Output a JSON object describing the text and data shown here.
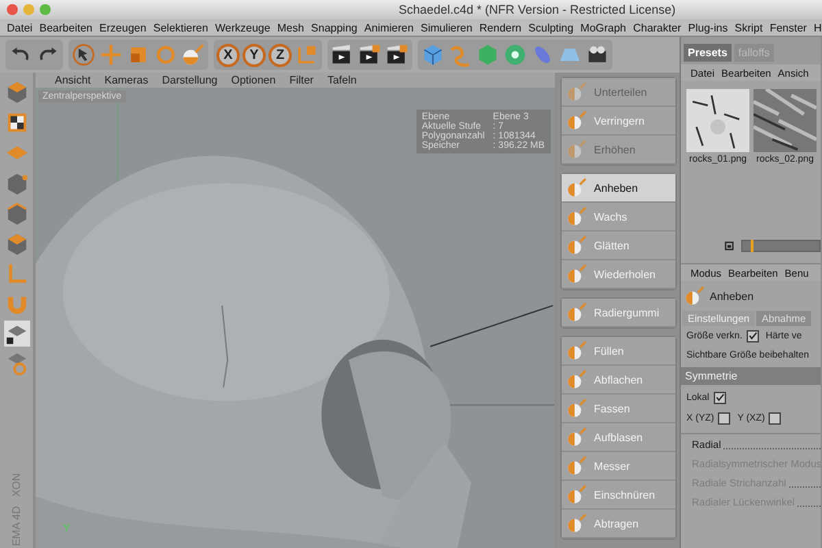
{
  "window": {
    "title": "Schaedel.c4d * (NFR Version - Restricted License)"
  },
  "menu": [
    "Datei",
    "Bearbeiten",
    "Erzeugen",
    "Selektieren",
    "Werkzeuge",
    "Mesh",
    "Snapping",
    "Animieren",
    "Simulieren",
    "Rendern",
    "Sculpting",
    "MoGraph",
    "Charakter",
    "Plug-ins",
    "Skript",
    "Fenster",
    "H"
  ],
  "toolbar": {
    "axes": [
      "X",
      "Y",
      "Z"
    ]
  },
  "viewport": {
    "menu": [
      "Ansicht",
      "Kameras",
      "Darstellung",
      "Optionen",
      "Filter",
      "Tafeln"
    ],
    "camera": "Zentralperspektive",
    "info": [
      {
        "label": "Ebene",
        "value": "Ebene 3"
      },
      {
        "label": "Aktuelle Stufe",
        "value": ": 7"
      },
      {
        "label": "Polygonanzahl",
        "value": ": 1081344"
      },
      {
        "label": "Speicher",
        "value": ": 396.22 MB"
      }
    ],
    "axis_label": "Y"
  },
  "logo": [
    "XON",
    "EMA 4D"
  ],
  "brushes": [
    {
      "items": [
        {
          "label": "Unterteilen",
          "selected": false,
          "disabled": true
        },
        {
          "label": "Verringern",
          "selected": false,
          "disabled": false
        },
        {
          "label": "Erhöhen",
          "selected": false,
          "disabled": true
        }
      ]
    },
    {
      "items": [
        {
          "label": "Anheben",
          "selected": true,
          "disabled": false
        },
        {
          "label": "Wachs",
          "selected": false,
          "disabled": false
        },
        {
          "label": "Glätten",
          "selected": false,
          "disabled": false
        },
        {
          "label": "Wiederholen",
          "selected": false,
          "disabled": false
        }
      ]
    },
    {
      "items": [
        {
          "label": "Radiergummi",
          "selected": false,
          "disabled": false
        }
      ]
    },
    {
      "items": [
        {
          "label": "Füllen",
          "selected": false,
          "disabled": false
        },
        {
          "label": "Abflachen",
          "selected": false,
          "disabled": false
        },
        {
          "label": "Fassen",
          "selected": false,
          "disabled": false
        },
        {
          "label": "Aufblasen",
          "selected": false,
          "disabled": false
        },
        {
          "label": "Messer",
          "selected": false,
          "disabled": false
        },
        {
          "label": "Einschnüren",
          "selected": false,
          "disabled": false
        },
        {
          "label": "Abtragen",
          "selected": false,
          "disabled": false
        }
      ]
    }
  ],
  "presets": {
    "tabs": [
      {
        "label": "Presets",
        "selected": true
      },
      {
        "label": "falloffs",
        "selected": false
      }
    ],
    "menu": [
      "Datei",
      "Bearbeiten",
      "Ansich"
    ],
    "files": [
      {
        "name": "rocks_01.png"
      },
      {
        "name": "rocks_02.png"
      }
    ],
    "level": 0.12
  },
  "attributes": {
    "menu": [
      "Modus",
      "Bearbeiten",
      "Benu"
    ],
    "tool": "Anheben",
    "tabs": [
      {
        "label": "Einstellungen",
        "selected": true
      },
      {
        "label": "Abnahme",
        "selected": false
      }
    ],
    "rows": [
      {
        "kind": "checks",
        "items": [
          {
            "label": "Größe verkn.",
            "checked": true
          },
          {
            "label": "Härte ve"
          }
        ]
      },
      {
        "kind": "checks",
        "items": [
          {
            "label": "Sichtbare Größe beibehalten"
          }
        ]
      },
      {
        "kind": "header",
        "label": "Symmetrie"
      },
      {
        "kind": "checks",
        "items": [
          {
            "label": "Lokal",
            "checked": true
          }
        ]
      },
      {
        "kind": "checks",
        "items": [
          {
            "label": "X (YZ)",
            "checked": false
          },
          {
            "label": "Y (XZ)",
            "checked": false
          }
        ]
      },
      {
        "kind": "field",
        "label": "Radial",
        "disabled": false
      },
      {
        "kind": "field",
        "label": "Radialsymmetrischer Modus",
        "disabled": true
      },
      {
        "kind": "field",
        "label": "Radiale Strichanzahl",
        "disabled": true
      },
      {
        "kind": "field",
        "label": "Radialer Lückenwinkel",
        "disabled": true
      }
    ]
  }
}
